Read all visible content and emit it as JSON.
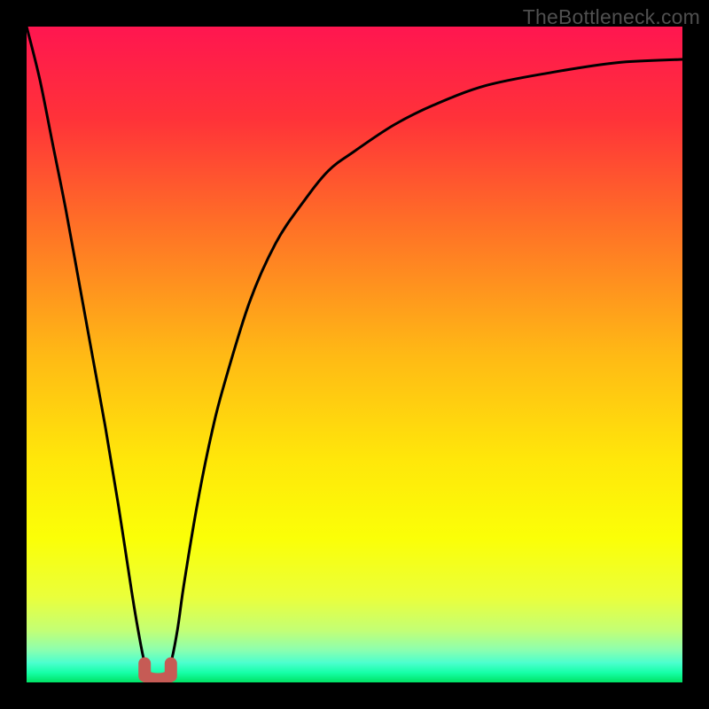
{
  "watermark": "TheBottleneck.com",
  "chart_data": {
    "type": "line",
    "title": "",
    "xlabel": "",
    "ylabel": "",
    "xlim": [
      0,
      100
    ],
    "ylim": [
      0,
      100
    ],
    "series": [
      {
        "name": "bottleneck-curve",
        "x": [
          0,
          2,
          4,
          6,
          8,
          10,
          12,
          14,
          16,
          17,
          18,
          19,
          20,
          21,
          22,
          23,
          24,
          26,
          28,
          30,
          34,
          38,
          42,
          46,
          50,
          56,
          62,
          70,
          80,
          90,
          100
        ],
        "y": [
          100,
          92,
          82,
          72,
          61,
          50,
          39,
          27,
          14,
          8,
          3,
          1,
          1,
          1,
          3,
          8,
          15,
          27,
          37,
          45,
          58,
          67,
          73,
          78,
          81,
          85,
          88,
          91,
          93,
          94.5,
          95
        ]
      }
    ],
    "minimum_marker": {
      "x_range": [
        18,
        22
      ],
      "y": 1
    },
    "gradient_stops": [
      {
        "pct": 0,
        "color": "#ff1650"
      },
      {
        "pct": 14,
        "color": "#ff3239"
      },
      {
        "pct": 30,
        "color": "#ff6f27"
      },
      {
        "pct": 50,
        "color": "#ffb915"
      },
      {
        "pct": 66,
        "color": "#ffe70a"
      },
      {
        "pct": 78,
        "color": "#fbff07"
      },
      {
        "pct": 87,
        "color": "#eaff3b"
      },
      {
        "pct": 92,
        "color": "#c4ff74"
      },
      {
        "pct": 95,
        "color": "#8dffae"
      },
      {
        "pct": 97,
        "color": "#4cffce"
      },
      {
        "pct": 98.5,
        "color": "#16ffa8"
      },
      {
        "pct": 100,
        "color": "#00e265"
      }
    ]
  }
}
